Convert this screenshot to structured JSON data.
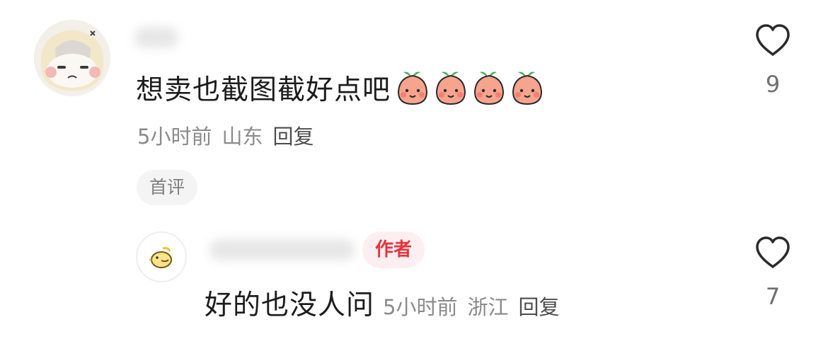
{
  "comment": {
    "text": "想卖也截图截好点吧",
    "emoji_count": 4,
    "emoji_icon": "smiling-peach-icon",
    "time": "5小时前",
    "location": "山东",
    "reply_label": "回复",
    "badge": "首评",
    "like_count": "9"
  },
  "reply": {
    "author_badge": "作者",
    "text": "好的也没人问",
    "time": "5小时前",
    "location": "浙江",
    "reply_label": "回复",
    "like_count": "7"
  },
  "colors": {
    "text_primary": "#1c1c1c",
    "text_meta": "#8a8a8a",
    "author_red": "#e8333e",
    "badge_bg": "#f4f4f4"
  }
}
